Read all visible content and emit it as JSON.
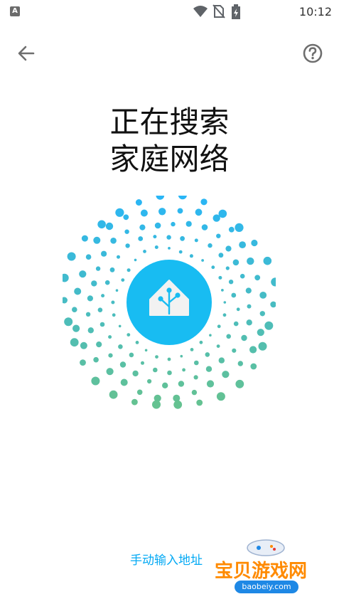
{
  "status_bar": {
    "app_badge_letter": "A",
    "time": "10:12",
    "icons": [
      "wifi-icon",
      "no-sim-icon",
      "battery-charging-icon"
    ]
  },
  "toolbar": {
    "back_icon": "arrow-left-icon",
    "help_icon": "help-circle-icon"
  },
  "title": {
    "line1": "正在搜索",
    "line2": "家庭网络"
  },
  "radar": {
    "center_icon": "home-assistant-logo-icon",
    "colors": {
      "primary": "#18bcf2",
      "dot_top": "#29b6f6",
      "dot_bottom": "#66c28f"
    }
  },
  "manual_entry": {
    "label": "手动输入地址"
  },
  "watermark": {
    "text": "宝贝游戏网",
    "domain": "baobeiy.com"
  }
}
